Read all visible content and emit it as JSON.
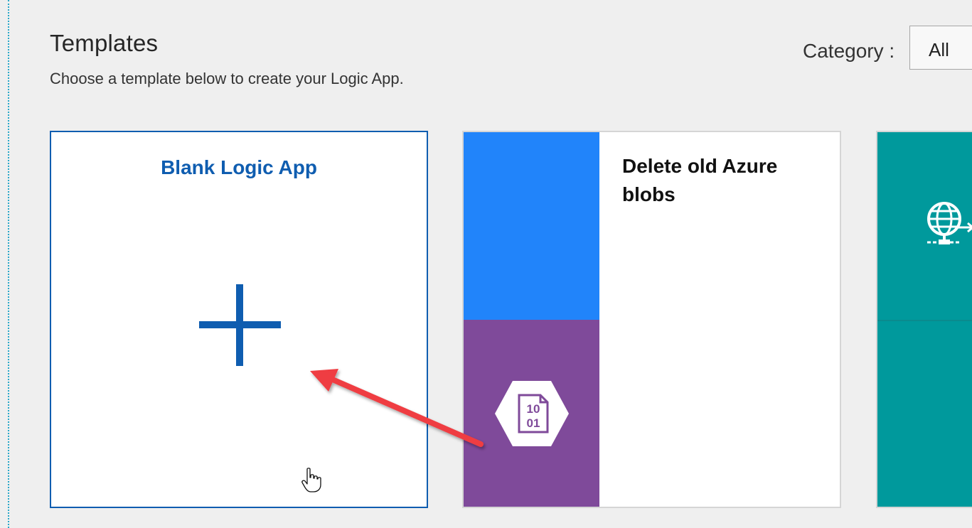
{
  "header": {
    "title": "Templates",
    "subtitle": "Choose a template below to create your Logic App."
  },
  "category": {
    "label": "Category :",
    "selected": "All"
  },
  "templates": [
    {
      "title": "Blank Logic App",
      "icon": "plus-icon"
    },
    {
      "title": "Delete old Azure blobs",
      "icon": "blob-storage-icon",
      "blob_icon_text_top": "10",
      "blob_icon_text_bottom": "01"
    },
    {
      "title": "",
      "icon": "globe-icon"
    }
  ],
  "colors": {
    "accent_blue": "#0f5db0",
    "tile_blue": "#2184fa",
    "tile_purple": "#7f4a9a",
    "tile_teal": "#00999c",
    "annotation_red": "#ef3e42"
  }
}
